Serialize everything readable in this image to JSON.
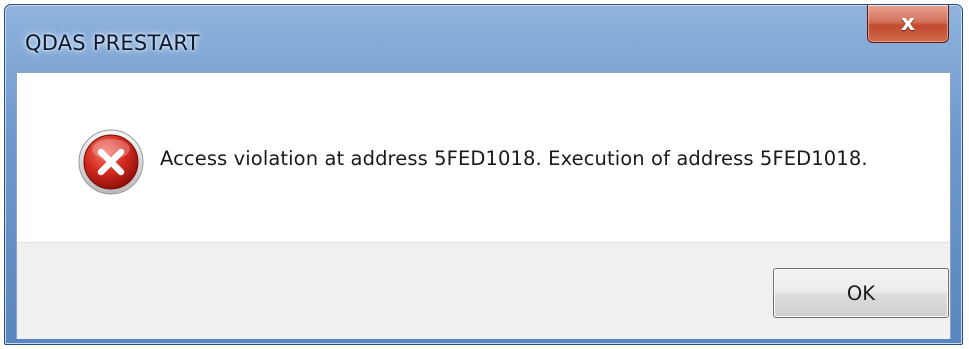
{
  "window": {
    "title": "QDAS PRESTART",
    "close_label": "x"
  },
  "dialog": {
    "icon": "error-icon",
    "message": "Access violation at address 5FED1018. Execution of address 5FED1018.",
    "ok_label": "OK"
  },
  "colors": {
    "title_bar": "#6e98cc",
    "close_button": "#c04a2e",
    "error_icon": "#c0211a",
    "button_area": "#f0f0f0"
  }
}
